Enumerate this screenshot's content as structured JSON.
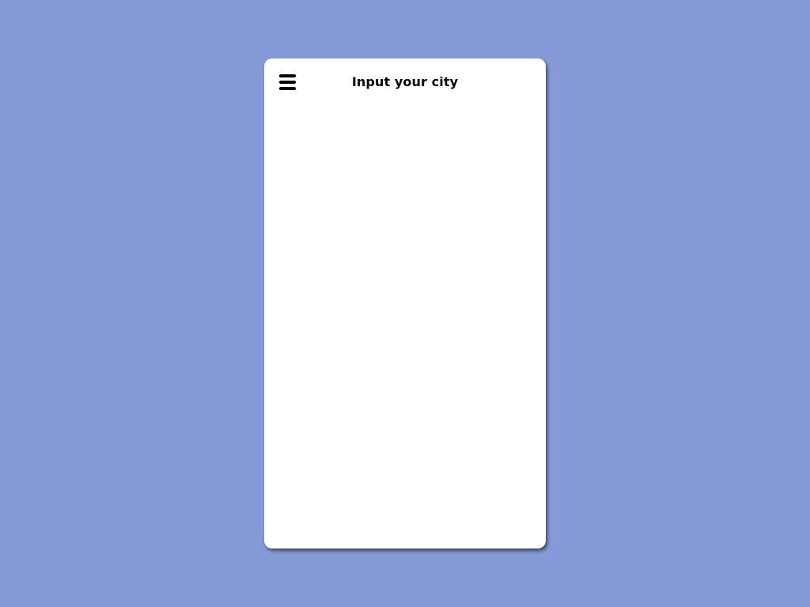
{
  "app": {
    "background_color": "#859ad6",
    "card_color": "#ffffff"
  },
  "header": {
    "title": "Input your city",
    "menu_icon": "hamburger-menu-icon"
  }
}
